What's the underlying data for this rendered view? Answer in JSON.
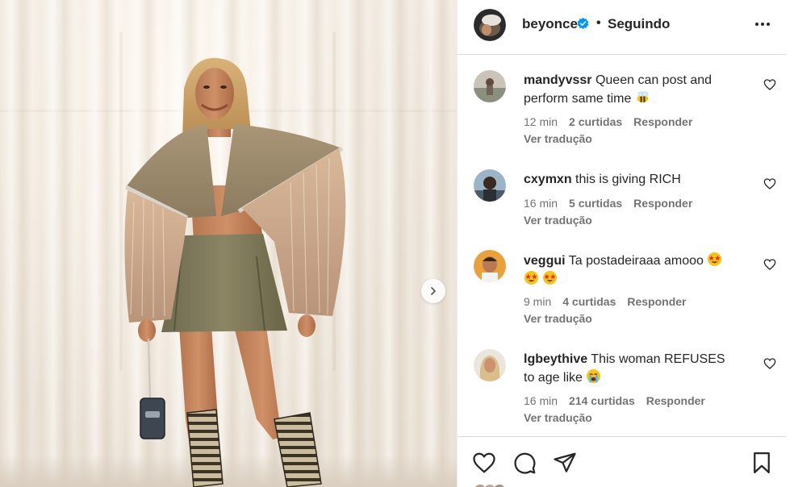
{
  "post": {
    "username": "beyonce",
    "separator": "•",
    "follow_state": "Seguindo"
  },
  "comments": [
    {
      "username": "mandyvssr",
      "text": "Queen can post and perform same time",
      "emojis": [
        "bee"
      ],
      "time": "12 min",
      "likes": "2 curtidas",
      "reply_label": "Responder",
      "translate_label": "Ver tradução"
    },
    {
      "username": "cxymxn",
      "text": "this is giving RICH",
      "emojis": [],
      "time": "16 min",
      "likes": "5 curtidas",
      "reply_label": "Responder",
      "translate_label": "Ver tradução"
    },
    {
      "username": "veggui",
      "text": "Ta postadeiraaa amooo",
      "emojis": [
        "star-struck",
        "star-struck",
        "star-struck"
      ],
      "time": "9 min",
      "likes": "4 curtidas",
      "reply_label": "Responder",
      "translate_label": "Ver tradução"
    },
    {
      "username": "lgbeythive",
      "text": "This woman REFUSES to age like",
      "emojis": [
        "loudly-crying-face"
      ],
      "time": "16 min",
      "likes": "214 curtidas",
      "reply_label": "Responder",
      "translate_label": "Ver tradução"
    }
  ],
  "icons": {
    "like": "heart-icon",
    "comment": "comment-icon",
    "share": "send-icon",
    "save": "bookmark-icon",
    "next": "chevron-right-icon",
    "more": "more-horizontal-icon",
    "verified": "verified-badge-icon"
  },
  "colors": {
    "verified": "#0095f6",
    "text": "#262626",
    "secondary": "#737373",
    "border": "#dbdbdb"
  }
}
